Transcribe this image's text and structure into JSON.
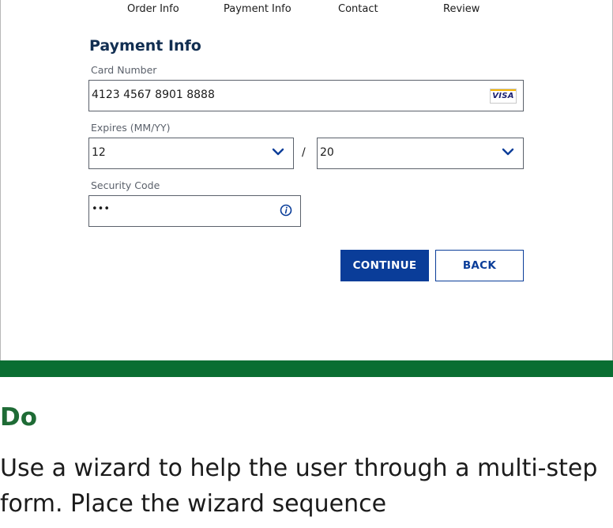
{
  "wizard": {
    "steps": [
      "Order Info",
      "Payment Info",
      "Contact",
      "Review"
    ]
  },
  "form": {
    "title": "Payment Info",
    "card_number_label": "Card Number",
    "card_number_value": "4123 4567 8901 8888",
    "card_brand": "VISA",
    "expires_label": "Expires (MM/YY)",
    "expires_month": "12",
    "expires_separator": "/",
    "expires_year": "20",
    "security_code_label": "Security Code",
    "security_code_value": "•••",
    "continue_label": "CONTINUE",
    "back_label": "BACK"
  },
  "guidance": {
    "heading": "Do",
    "body": "Use a wizard to help the user through a multi-step form. Place the wizard sequence"
  },
  "colors": {
    "primary": "#0a3d99",
    "heading": "#112e51",
    "do_green": "#1e6b35",
    "bar_green": "#0a6e32"
  }
}
